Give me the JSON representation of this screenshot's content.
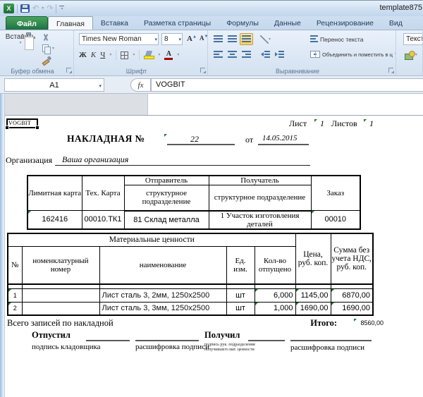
{
  "titlebar": {
    "title": "template875"
  },
  "tabs": {
    "file": "Файл",
    "items": [
      "Главная",
      "Вставка",
      "Разметка страницы",
      "Формулы",
      "Данные",
      "Рецензирование",
      "Вид"
    ]
  },
  "ribbon": {
    "clipboard": {
      "paste": "Вставить",
      "label": "Буфер обмена"
    },
    "font": {
      "family": "Times New Roman",
      "size": "8",
      "bold": "Ж",
      "italic": "К",
      "underline": "Ч",
      "letter": "А",
      "label": "Шрифт"
    },
    "alignment": {
      "wrap": "Перенос текста",
      "merge": "Объединить и поместить в центре",
      "label": "Выравнивание"
    },
    "number": {
      "format": "Тексто"
    }
  },
  "formula_bar": {
    "cell_ref": "A1",
    "fx": "fx",
    "value": "VOGBIT"
  },
  "sheet": {
    "a1": "VOGBIT",
    "header": {
      "sheet_label": "Лист",
      "sheet_num": "1",
      "sheets_label": "Листов",
      "sheets_num": "1"
    },
    "title": {
      "label": "НАКЛАДНАЯ №",
      "number": "22",
      "of": "от",
      "date": "14.05.2015"
    },
    "org": {
      "label": "Организация",
      "value": "Ваша организация"
    },
    "table1": {
      "limit_header": "Лимитная карта",
      "tech_header": "Тех. Карта",
      "sender_header": "Отправитель",
      "receiver_header": "Получатель",
      "sub_header": "структурное подразделение",
      "order_header": "Заказ",
      "limit": "162416",
      "tech": "00010.ТК1",
      "sender": "81 Склад металла",
      "receiver": "1 Участок изготовления деталей",
      "order": "00010"
    },
    "table2": {
      "group_header": "Материальные ценности",
      "col_num": "№",
      "col_nomenclature": "номенклатурный номер",
      "col_name": "наименование",
      "col_unit": "Ед.\nизм.",
      "col_qty": "Кол-во отпущено",
      "col_price": "Цена,\nруб. коп.",
      "col_sum": "Сумма без учета НДС, руб. коп.",
      "rows": [
        {
          "num": "1",
          "nomenclature": "",
          "name": "Лист сталь 3, 2мм, 1250х2500",
          "unit": "шт",
          "qty": "6,000",
          "price": "1145,00",
          "sum": "6870,00"
        },
        {
          "num": "2",
          "nomenclature": "",
          "name": "Лист сталь 3, 3мм, 1250х2500",
          "unit": "шт",
          "qty": "1,000",
          "price": "1690,00",
          "sum": "1690,00"
        }
      ],
      "footer_label": "Всего записей по накладной",
      "total_label": "Итого:",
      "total_value": "8560,00"
    },
    "signatures": {
      "released_label": "Отпустил",
      "released_sub1": "подпись кладовщика",
      "released_sub2": "расшифровка подписи",
      "received_label": "Получил",
      "received_sub1": "подпись рук. подразделения\nполучившего мат. ценности",
      "received_sub2": "расшифровка подписи"
    }
  }
}
